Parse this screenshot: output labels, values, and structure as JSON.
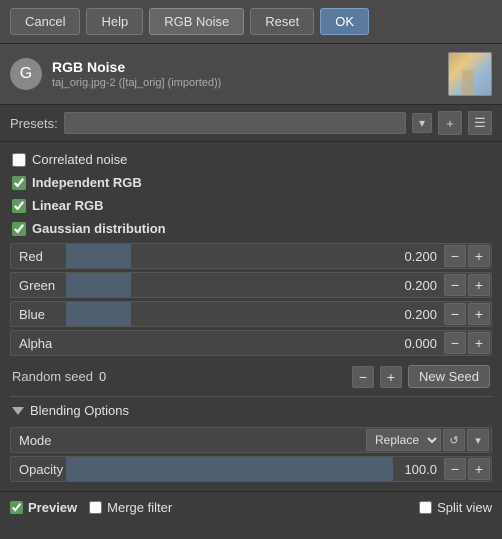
{
  "toolbar": {
    "cancel_label": "Cancel",
    "help_label": "Help",
    "rgb_noise_label": "RGB Noise",
    "reset_label": "Reset",
    "ok_label": "OK"
  },
  "header": {
    "icon_letter": "G",
    "filter_name": "RGB Noise",
    "subtitle": "taj_orig.jpg-2 ([taj_orig] (imported))"
  },
  "presets": {
    "label": "Presets:",
    "value": "",
    "add_icon": "+",
    "menu_icon": "☰"
  },
  "options": {
    "correlated_noise_label": "Correlated noise",
    "correlated_noise_checked": false,
    "independent_rgb_label": "Independent RGB",
    "independent_rgb_checked": true,
    "linear_rgb_label": "Linear RGB",
    "linear_rgb_checked": true,
    "gaussian_distribution_label": "Gaussian distribution",
    "gaussian_distribution_checked": true
  },
  "sliders": [
    {
      "label": "Red",
      "value": "0.200",
      "fill_pct": 20
    },
    {
      "label": "Green",
      "value": "0.200",
      "fill_pct": 20
    },
    {
      "label": "Blue",
      "value": "0.200",
      "fill_pct": 20
    },
    {
      "label": "Alpha",
      "value": "0.000",
      "fill_pct": 0
    }
  ],
  "seed": {
    "label": "Random seed",
    "value": "0",
    "new_seed_label": "New Seed"
  },
  "blending": {
    "title": "Blending Options",
    "mode_label": "Mode",
    "mode_value": "Replace",
    "opacity_label": "Opacity",
    "opacity_value": "100.0"
  },
  "bottom": {
    "preview_label": "Preview",
    "merge_label": "Merge filter",
    "split_label": "Split view"
  }
}
